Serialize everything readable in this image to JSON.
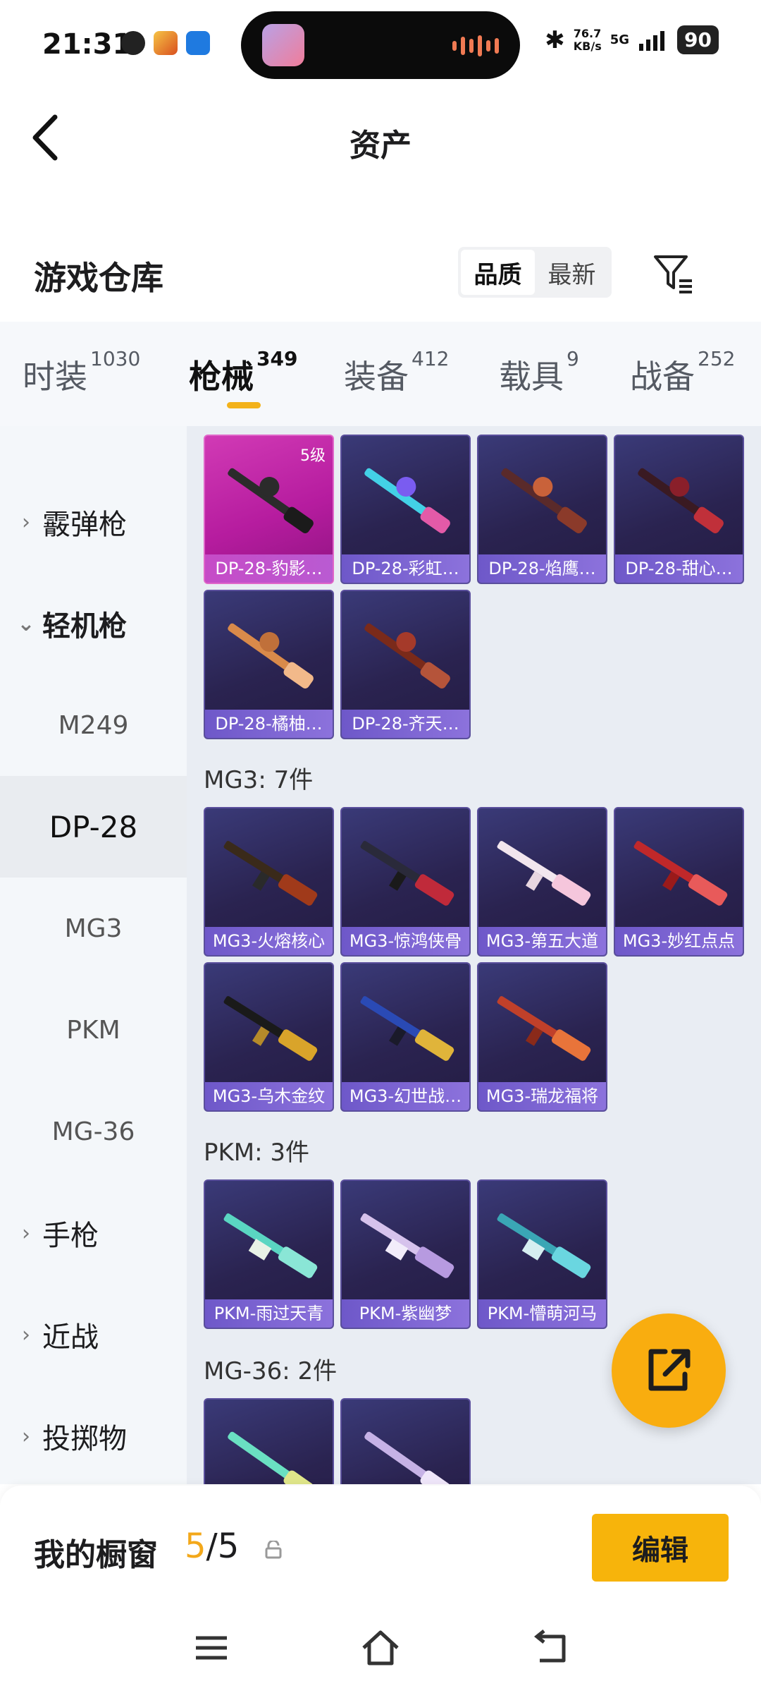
{
  "status": {
    "time": "21:31",
    "net_speed": "76.7",
    "net_unit": "KB/s",
    "signal": "5G",
    "battery": "90"
  },
  "header": {
    "title": "资产"
  },
  "warehouse": {
    "title": "游戏仓库",
    "sort": [
      "品质",
      "最新"
    ]
  },
  "tabs": [
    {
      "label": "时装",
      "count": "1030"
    },
    {
      "label": "枪械",
      "count": "349"
    },
    {
      "label": "装备",
      "count": "412"
    },
    {
      "label": "载具",
      "count": "9"
    },
    {
      "label": "战备",
      "count": "252"
    }
  ],
  "sidebar": {
    "items": [
      {
        "label": "霰弹枪"
      },
      {
        "label": "轻机枪"
      },
      {
        "label": "M249"
      },
      {
        "label": "DP-28"
      },
      {
        "label": "MG3"
      },
      {
        "label": "PKM"
      },
      {
        "label": "MG-36"
      },
      {
        "label": "手枪"
      },
      {
        "label": "近战"
      },
      {
        "label": "投掷物"
      }
    ]
  },
  "sections": {
    "dp28": {
      "items": [
        {
          "name": "DP-28-豹影…",
          "level": "5级"
        },
        {
          "name": "DP-28-彩虹…"
        },
        {
          "name": "DP-28-焰鹰…"
        },
        {
          "name": "DP-28-甜心…"
        },
        {
          "name": "DP-28-橘柚…"
        },
        {
          "name": "DP-28-齐天…"
        }
      ]
    },
    "mg3": {
      "label": "MG3: 7件",
      "items": [
        {
          "name": "MG3-火熔核心"
        },
        {
          "name": "MG3-惊鸿侠骨"
        },
        {
          "name": "MG3-第五大道"
        },
        {
          "name": "MG3-妙红点点"
        },
        {
          "name": "MG3-乌木金纹"
        },
        {
          "name": "MG3-幻世战…"
        },
        {
          "name": "MG3-瑞龙福将"
        }
      ]
    },
    "pkm": {
      "label": "PKM: 3件",
      "items": [
        {
          "name": "PKM-雨过天青"
        },
        {
          "name": "PKM-紫幽梦"
        },
        {
          "name": "PKM-懵萌河马"
        }
      ]
    },
    "mg36": {
      "label": "MG-36: 2件"
    }
  },
  "bottom": {
    "shelf_label": "我的橱窗",
    "shelf_current": "5",
    "shelf_total": "/5",
    "edit_label": "编辑"
  }
}
